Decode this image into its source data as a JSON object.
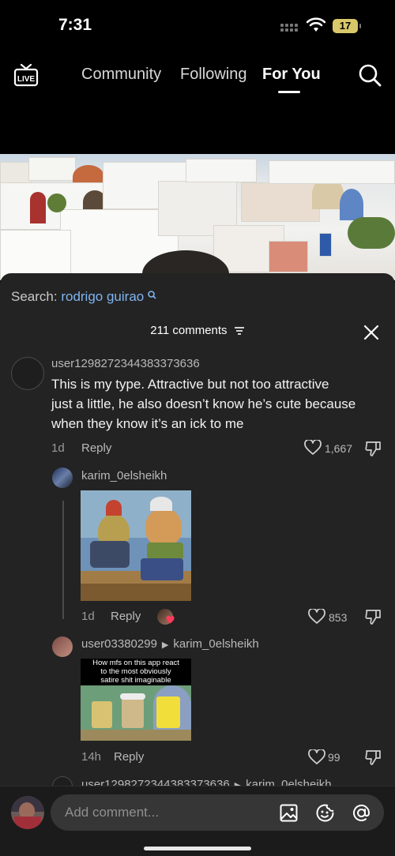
{
  "status_bar": {
    "time": "7:31",
    "battery": "17"
  },
  "nav": {
    "tabs": [
      {
        "label": "Community"
      },
      {
        "label": "Following"
      },
      {
        "label": "For You"
      }
    ],
    "live_icon": "live-tv-icon",
    "search_icon": "search-icon"
  },
  "sheet": {
    "search_prefix": "Search:",
    "search_term": "rodrigo guirao",
    "comment_count": "211 comments",
    "comments": [
      {
        "username": "user1298272344383373636",
        "text_lines": [
          "This is my type. Attractive but not too attractive",
          "just a little, he also doesn’t know he’s cute because",
          "when they know it’s an ick to me"
        ],
        "age": "1d",
        "reply_label": "Reply",
        "likes": "1,667"
      },
      {
        "username": "karim_0elsheikh",
        "age": "1d",
        "reply_label": "Reply",
        "likes": "853"
      },
      {
        "username": "user03380299",
        "reply_to": "karim_0elsheikh",
        "gif_caption_lines": [
          "How mfs on this app react",
          "to the most obviously",
          "satire shit imaginable"
        ],
        "age": "14h",
        "reply_label": "Reply",
        "likes": "99"
      },
      {
        "username": "user1298272344383373636",
        "reply_to": "karim_0elsheikh"
      }
    ]
  },
  "input": {
    "placeholder": "Add comment..."
  },
  "colors": {
    "sheet_bg": "#232323",
    "link_blue": "#7fb4f0",
    "battery_yellow": "#d9c86a"
  }
}
